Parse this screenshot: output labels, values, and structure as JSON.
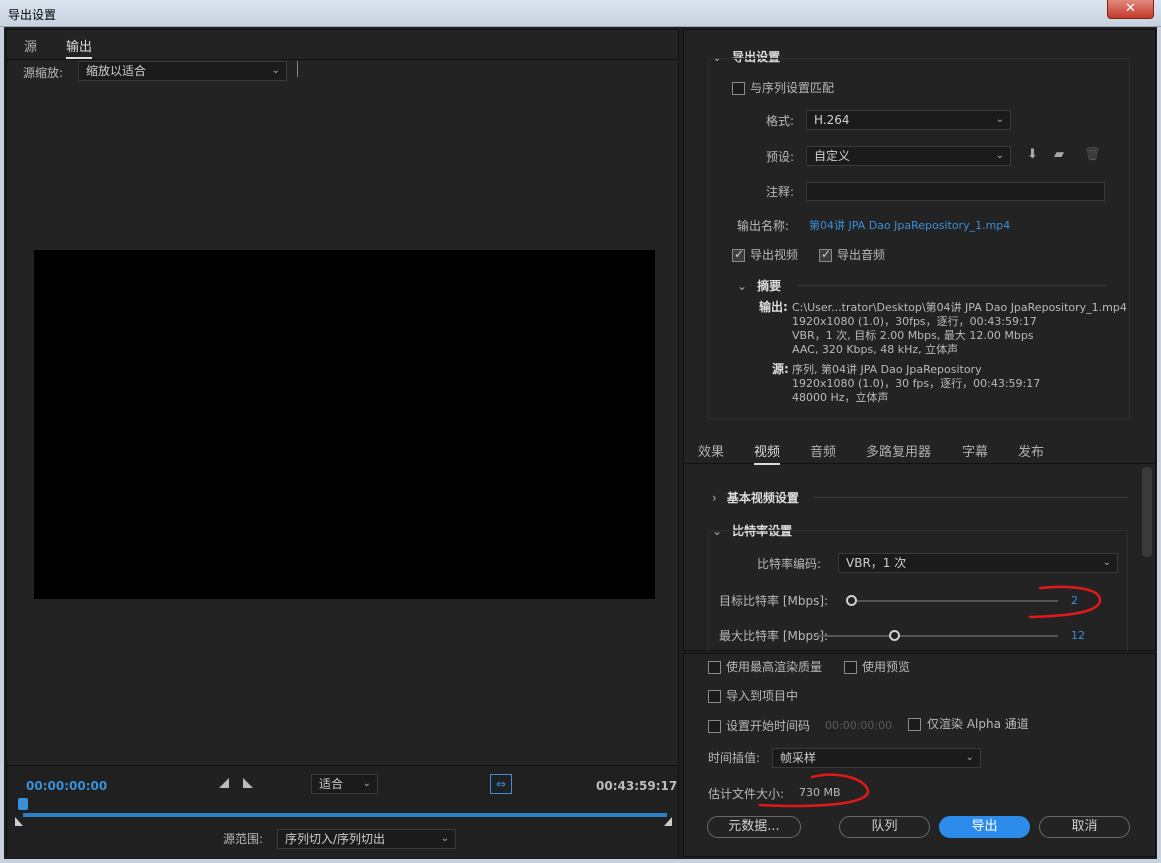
{
  "window": {
    "title": "导出设置",
    "close_glyph": "✕"
  },
  "left": {
    "tabs": [
      "源",
      "输出"
    ],
    "source_scale_label": "源缩放:",
    "source_scale_value": "缩放以适合",
    "timecode_start": "00:00:00:00",
    "timecode_end": "00:43:59:17",
    "fit_value": "适合",
    "range_label": "源范围:",
    "range_value": "序列切入/序列切出"
  },
  "export_settings": {
    "header": "导出设置",
    "match_sequence_label": "与序列设置匹配",
    "format_label": "格式:",
    "format_value": "H.264",
    "preset_label": "预设:",
    "preset_value": "自定义",
    "comments_label": "注释:",
    "comments_value": "",
    "output_name_label": "输出名称:",
    "output_name_value": "第04讲 JPA Dao JpaRepository_1.mp4",
    "export_video_label": "导出视频",
    "export_audio_label": "导出音频",
    "summary_header": "摘要",
    "summary": {
      "output_key": "输出:",
      "output_lines": [
        "C:\\User...trator\\Desktop\\第04讲 JPA Dao JpaRepository_1.mp4",
        "1920x1080 (1.0)，30fps，逐行，00:43:59:17",
        "VBR，1 次, 目标 2.00 Mbps, 最大 12.00 Mbps",
        "AAC, 320 Kbps, 48  kHz, 立体声"
      ],
      "source_key": "源:",
      "source_lines": [
        "序列, 第04讲 JPA Dao JpaRepository",
        "1920x1080 (1.0)，30 fps，逐行，00:43:59:17",
        "48000 Hz，立体声"
      ]
    }
  },
  "settings_tabs": [
    "效果",
    "视频",
    "音频",
    "多路复用器",
    "字幕",
    "发布"
  ],
  "video": {
    "basic_header": "基本视频设置",
    "bitrate_header": "比特率设置",
    "bitrate_encoding_label": "比特率编码:",
    "bitrate_encoding_value": "VBR，1 次",
    "target_bitrate_label": "目标比特率 [Mbps]:",
    "target_bitrate_value": "2",
    "target_bitrate_level": 0.0,
    "max_bitrate_label": "最大比特率 [Mbps]:",
    "max_bitrate_value": "12",
    "max_bitrate_level": 0.3
  },
  "bottom": {
    "max_render_quality": "使用最高渲染质量",
    "use_previews": "使用预览",
    "import_into_project": "导入到项目中",
    "set_start_timecode": "设置开始时间码",
    "start_timecode_value": "00:00:00:00",
    "render_alpha_only": "仅渲染 Alpha 通道",
    "time_interpolation_label": "时间插值:",
    "time_interpolation_value": "帧采样",
    "estimated_size_label": "估计文件大小:",
    "estimated_size_value": "730 MB",
    "metadata_button": "元数据...",
    "queue_button": "队列",
    "export_button": "导出",
    "cancel_button": "取消"
  },
  "colors": {
    "accent": "#2d8ceb",
    "link": "#3a8fd8",
    "annotation": "#e0191b"
  }
}
